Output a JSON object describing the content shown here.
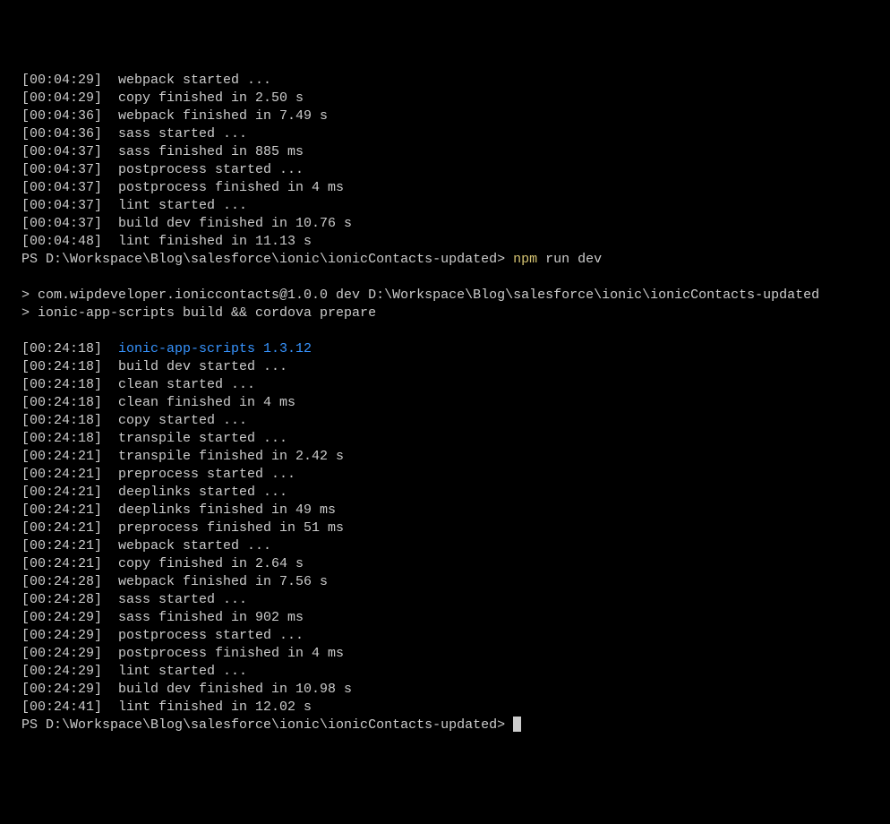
{
  "block1": {
    "lines": [
      {
        "ts": "[00:04:29]",
        "msg": "webpack started ..."
      },
      {
        "ts": "[00:04:29]",
        "msg": "copy finished in 2.50 s"
      },
      {
        "ts": "[00:04:36]",
        "msg": "webpack finished in 7.49 s"
      },
      {
        "ts": "[00:04:36]",
        "msg": "sass started ..."
      },
      {
        "ts": "[00:04:37]",
        "msg": "sass finished in 885 ms"
      },
      {
        "ts": "[00:04:37]",
        "msg": "postprocess started ..."
      },
      {
        "ts": "[00:04:37]",
        "msg": "postprocess finished in 4 ms"
      },
      {
        "ts": "[00:04:37]",
        "msg": "lint started ..."
      },
      {
        "ts": "[00:04:37]",
        "msg": "build dev finished in 10.76 s"
      },
      {
        "ts": "[00:04:48]",
        "msg": "lint finished in 11.13 s"
      }
    ]
  },
  "prompt1": {
    "path": "PS D:\\Workspace\\Blog\\salesforce\\ionic\\ionicContacts-updated>",
    "cmd_highlight": "npm",
    "cmd_rest": " run dev"
  },
  "npm_output": {
    "line1": "> com.wipdeveloper.ioniccontacts@1.0.0 dev D:\\Workspace\\Blog\\salesforce\\ionic\\ionicContacts-updated",
    "line2": "> ionic-app-scripts build && cordova prepare"
  },
  "block2_header": {
    "ts": "[00:24:18]",
    "highlight": "ionic-app-scripts 1.3.12"
  },
  "block2": {
    "lines": [
      {
        "ts": "[00:24:18]",
        "msg": "build dev started ..."
      },
      {
        "ts": "[00:24:18]",
        "msg": "clean started ..."
      },
      {
        "ts": "[00:24:18]",
        "msg": "clean finished in 4 ms"
      },
      {
        "ts": "[00:24:18]",
        "msg": "copy started ..."
      },
      {
        "ts": "[00:24:18]",
        "msg": "transpile started ..."
      },
      {
        "ts": "[00:24:21]",
        "msg": "transpile finished in 2.42 s"
      },
      {
        "ts": "[00:24:21]",
        "msg": "preprocess started ..."
      },
      {
        "ts": "[00:24:21]",
        "msg": "deeplinks started ..."
      },
      {
        "ts": "[00:24:21]",
        "msg": "deeplinks finished in 49 ms"
      },
      {
        "ts": "[00:24:21]",
        "msg": "preprocess finished in 51 ms"
      },
      {
        "ts": "[00:24:21]",
        "msg": "webpack started ..."
      },
      {
        "ts": "[00:24:21]",
        "msg": "copy finished in 2.64 s"
      },
      {
        "ts": "[00:24:28]",
        "msg": "webpack finished in 7.56 s"
      },
      {
        "ts": "[00:24:28]",
        "msg": "sass started ..."
      },
      {
        "ts": "[00:24:29]",
        "msg": "sass finished in 902 ms"
      },
      {
        "ts": "[00:24:29]",
        "msg": "postprocess started ..."
      },
      {
        "ts": "[00:24:29]",
        "msg": "postprocess finished in 4 ms"
      },
      {
        "ts": "[00:24:29]",
        "msg": "lint started ..."
      },
      {
        "ts": "[00:24:29]",
        "msg": "build dev finished in 10.98 s"
      },
      {
        "ts": "[00:24:41]",
        "msg": "lint finished in 12.02 s"
      }
    ]
  },
  "prompt2": {
    "path": "PS D:\\Workspace\\Blog\\salesforce\\ionic\\ionicContacts-updated>"
  }
}
